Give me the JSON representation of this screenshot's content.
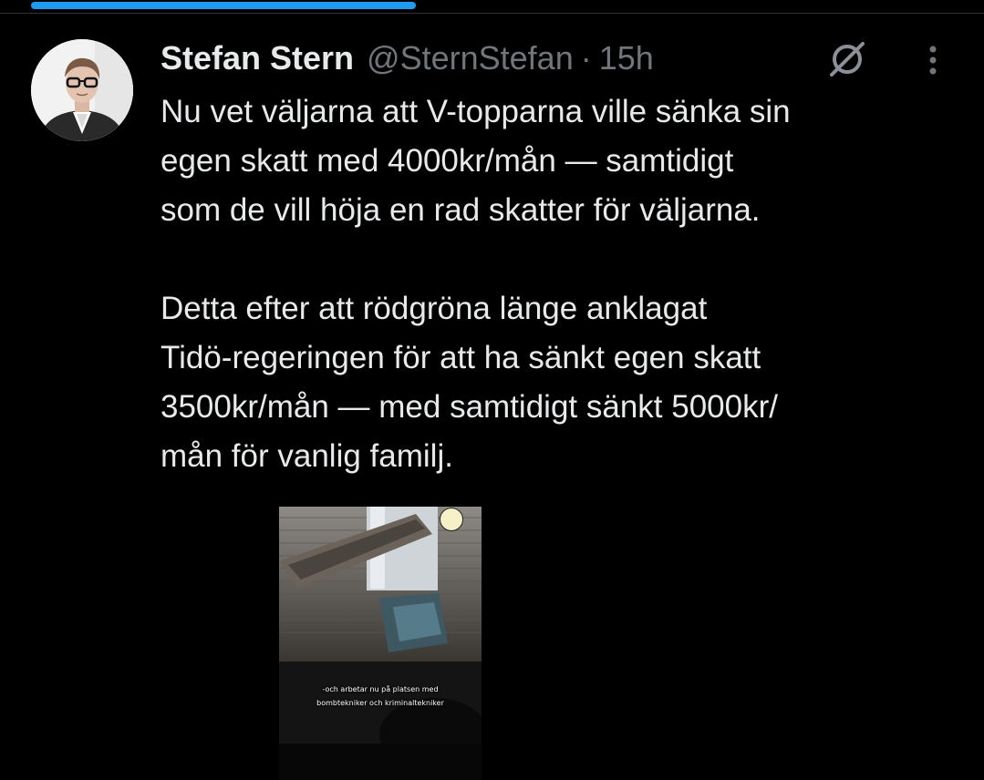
{
  "progress": {
    "fraction": 0.39,
    "color": "#1d9bf0"
  },
  "author": {
    "name": "Stefan Stern",
    "handle": "@SternStefan",
    "separator": "·",
    "time": "15h"
  },
  "icons": {
    "avatar": "profile-photo",
    "grok": "grok-icon",
    "more": "more-vertical-icon",
    "media_badge": "bell-icon"
  },
  "tweet": {
    "paragraph_1": "Nu vet väljarna att V-topparna ville sänka sin\negen skatt med 4000kr/mån — samtidigt\nsom de vill höja en rad skatter för väljarna.",
    "paragraph_2": "Detta efter att rödgröna länge anklagat\nTidö-regeringen för att ha sänkt egen skatt\n3500kr/mån — med samtidigt sänkt 5000kr/\nmån för vanlig familj."
  },
  "media": {
    "caption_line_1": "-och arbetar nu på platsen med",
    "caption_line_2": "bombtekniker och kriminaltekniker"
  },
  "colors": {
    "background": "#000000",
    "text_primary": "#e7e9ea",
    "text_secondary": "#71767b",
    "accent": "#1d9bf0"
  }
}
